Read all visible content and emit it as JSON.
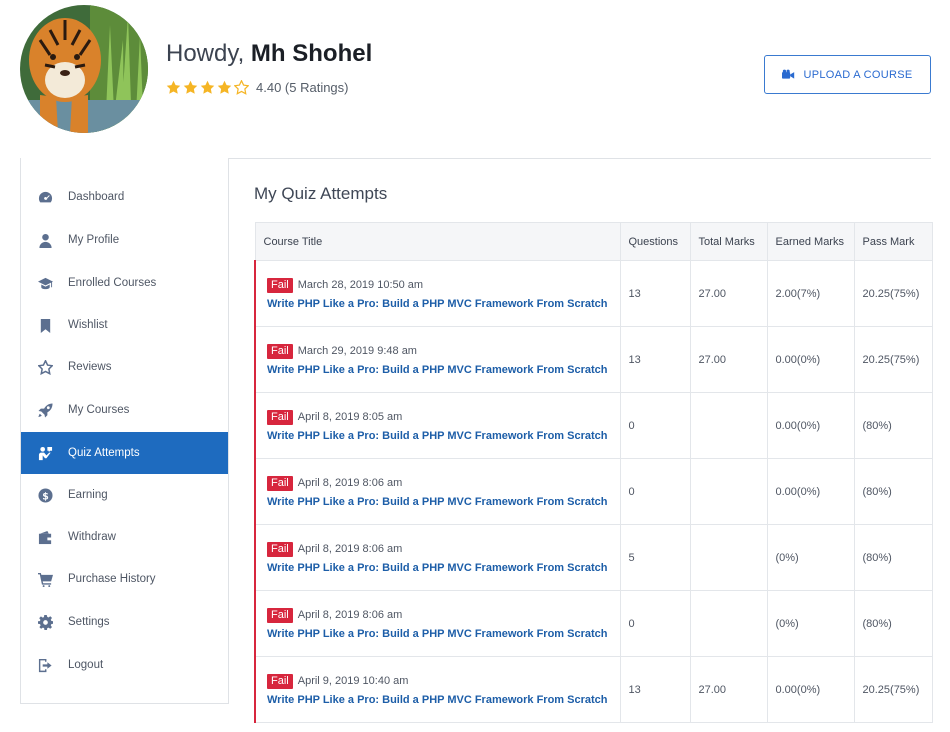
{
  "header": {
    "greeting": "Howdy,",
    "user_name": "Mh Shohel",
    "rating_value": 4.4,
    "rating_stars_filled": 4,
    "rating_stars_total": 5,
    "rating_text": "4.40 (5 Ratings)",
    "upload_button_label": "UPLOAD A COURSE",
    "upload_icon": "video-camera-icon",
    "star_color": "#f5b525"
  },
  "sidebar": {
    "active_color": "#1e6bbf",
    "items": [
      {
        "label": "Dashboard",
        "icon": "dashboard-icon",
        "active": false
      },
      {
        "label": "My Profile",
        "icon": "user-icon",
        "active": false
      },
      {
        "label": "Enrolled Courses",
        "icon": "graduation-cap-icon",
        "active": false
      },
      {
        "label": "Wishlist",
        "icon": "bookmark-icon",
        "active": false
      },
      {
        "label": "Reviews",
        "icon": "star-icon",
        "active": false
      },
      {
        "label": "My Courses",
        "icon": "rocket-icon",
        "active": false
      },
      {
        "label": "Quiz Attempts",
        "icon": "quiz-icon",
        "active": true
      },
      {
        "label": "Earning",
        "icon": "dollar-icon",
        "active": false
      },
      {
        "label": "Withdraw",
        "icon": "wallet-icon",
        "active": false
      },
      {
        "label": "Purchase History",
        "icon": "cart-icon",
        "active": false
      },
      {
        "label": "Settings",
        "icon": "gear-icon",
        "active": false
      },
      {
        "label": "Logout",
        "icon": "logout-icon",
        "active": false
      }
    ]
  },
  "main": {
    "title": "My Quiz Attempts",
    "table": {
      "headers": [
        "Course Title",
        "Questions",
        "Total Marks",
        "Earned Marks",
        "Pass Mark"
      ],
      "rows": [
        {
          "status": "Fail",
          "date": "March 28, 2019 10:50 am",
          "course": "Write PHP Like a Pro: Build a PHP MVC Framework From Scratch",
          "questions": "13",
          "total_marks": "27.00",
          "earned_marks": "2.00(7%)",
          "pass_mark": "20.25(75%)"
        },
        {
          "status": "Fail",
          "date": "March 29, 2019 9:48 am",
          "course": "Write PHP Like a Pro: Build a PHP MVC Framework From Scratch",
          "questions": "13",
          "total_marks": "27.00",
          "earned_marks": "0.00(0%)",
          "pass_mark": "20.25(75%)"
        },
        {
          "status": "Fail",
          "date": "April 8, 2019 8:05 am",
          "course": "Write PHP Like a Pro: Build a PHP MVC Framework From Scratch",
          "questions": "0",
          "total_marks": "",
          "earned_marks": "0.00(0%)",
          "pass_mark": "(80%)"
        },
        {
          "status": "Fail",
          "date": "April 8, 2019 8:06 am",
          "course": "Write PHP Like a Pro: Build a PHP MVC Framework From Scratch",
          "questions": "0",
          "total_marks": "",
          "earned_marks": "0.00(0%)",
          "pass_mark": "(80%)"
        },
        {
          "status": "Fail",
          "date": "April 8, 2019 8:06 am",
          "course": "Write PHP Like a Pro: Build a PHP MVC Framework From Scratch",
          "questions": "5",
          "total_marks": "",
          "earned_marks": "(0%)",
          "pass_mark": "(80%)"
        },
        {
          "status": "Fail",
          "date": "April 8, 2019 8:06 am",
          "course": "Write PHP Like a Pro: Build a PHP MVC Framework From Scratch",
          "questions": "0",
          "total_marks": "",
          "earned_marks": "(0%)",
          "pass_mark": "(80%)"
        },
        {
          "status": "Fail",
          "date": "April 9, 2019 10:40 am",
          "course": "Write PHP Like a Pro: Build a PHP MVC Framework From Scratch",
          "questions": "13",
          "total_marks": "27.00",
          "earned_marks": "0.00(0%)",
          "pass_mark": "20.25(75%)"
        }
      ]
    },
    "fail_color": "#d7263d",
    "link_color": "#1d5ea8"
  }
}
